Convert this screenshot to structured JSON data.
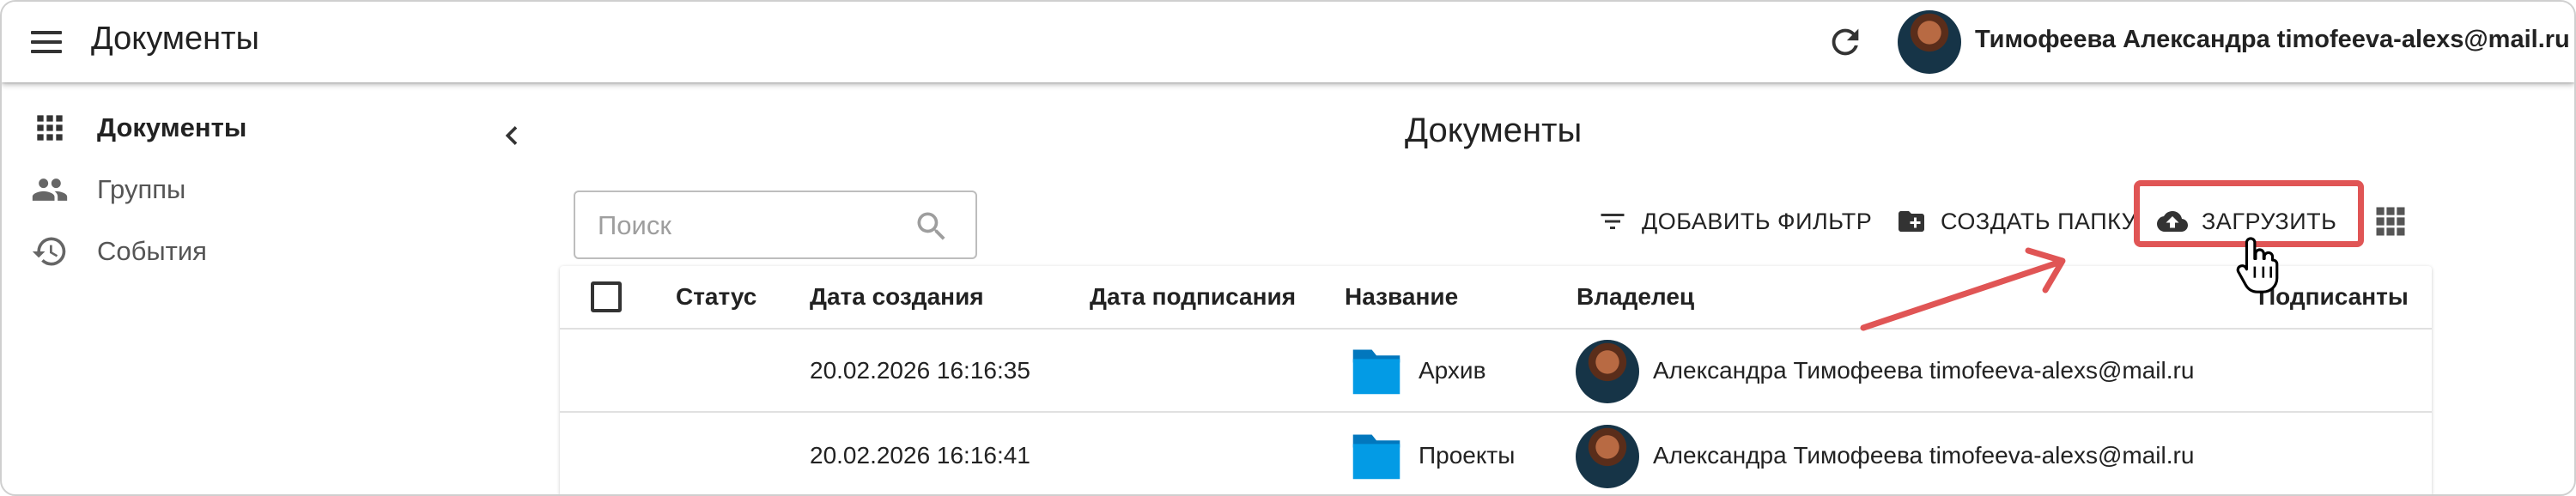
{
  "header": {
    "title": "Документы",
    "user": "Тимофеева Александра timofeeva-alexs@mail.ru"
  },
  "sidebar": {
    "items": [
      {
        "label": "Документы",
        "icon": "grid-icon",
        "active": true
      },
      {
        "label": "Группы",
        "icon": "people-icon",
        "active": false
      },
      {
        "label": "События",
        "icon": "history-icon",
        "active": false
      }
    ]
  },
  "main": {
    "heading": "Документы",
    "search_placeholder": "Поиск",
    "toolbar": {
      "add_filter": "ДОБАВИТЬ ФИЛЬТР",
      "create_folder": "СОЗДАТЬ ПАПКУ",
      "upload": "ЗАГРУЗИТЬ"
    },
    "table": {
      "columns": [
        "Статус",
        "Дата создания",
        "Дата подписания",
        "Название",
        "Владелец",
        "Подписанты"
      ],
      "rows": [
        {
          "status": "",
          "created": "20.02.2026 16:16:35",
          "signed": "",
          "name": "Архив",
          "owner": "Александра Тимофеева timofeeva-alexs@mail.ru",
          "signers": ""
        },
        {
          "status": "",
          "created": "20.02.2026 16:16:41",
          "signed": "",
          "name": "Проекты",
          "owner": "Александра Тимофеева timofeeva-alexs@mail.ru",
          "signers": ""
        }
      ]
    }
  },
  "colors": {
    "annotation_red": "#e05555",
    "folder_blue": "#039be5"
  }
}
